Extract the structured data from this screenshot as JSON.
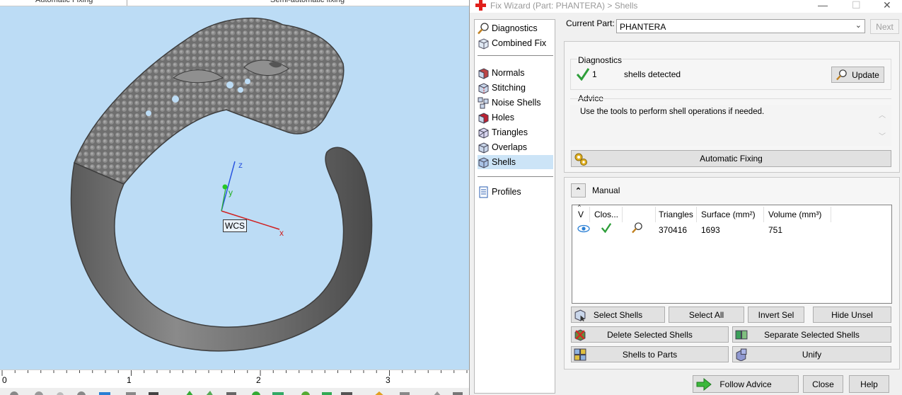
{
  "viewport": {
    "top_tabs": [
      "Automatic Fixing",
      "Semi-automatic fixing"
    ],
    "axis_labels": {
      "z": "z",
      "y": "y",
      "x": "x",
      "wcs": "WCS"
    },
    "ruler": [
      "0",
      "1",
      "2",
      "3"
    ]
  },
  "dialog": {
    "title": "Fix Wizard (Part: PHANTERA) > Shells",
    "nav": [
      {
        "label": "Diagnostics",
        "icon": "magnifier-icon"
      },
      {
        "label": "Combined Fix",
        "icon": "cube-icon"
      },
      {
        "label": "Normals",
        "icon": "normals-cube-icon"
      },
      {
        "label": "Stitching",
        "icon": "stitching-cube-icon"
      },
      {
        "label": "Noise Shells",
        "icon": "noise-shells-icon"
      },
      {
        "label": "Holes",
        "icon": "holes-cube-icon"
      },
      {
        "label": "Triangles",
        "icon": "triangles-cube-icon"
      },
      {
        "label": "Overlaps",
        "icon": "overlaps-cube-icon"
      },
      {
        "label": "Shells",
        "icon": "shells-cube-icon"
      },
      {
        "label": "Profiles",
        "icon": "document-icon"
      }
    ],
    "current_part_label": "Current Part:",
    "current_part_value": "PHANTERA",
    "next_label": "Next",
    "diagnostics": {
      "title": "Diagnostics",
      "count": "1",
      "text": "shells detected",
      "update_label": "Update"
    },
    "advice": {
      "title": "Advice",
      "text": "Use the tools to perform shell operations if needed."
    },
    "automatic_fixing_label": "Automatic Fixing",
    "manual": {
      "title": "Manual",
      "columns": [
        "V",
        "Clos...",
        "",
        "Triangles",
        "Surface (mm²)",
        "Volume (mm³)"
      ],
      "row": {
        "triangles": "370416",
        "surface": "1693",
        "volume": "751"
      }
    },
    "buttons": {
      "select_shells": "Select Shells",
      "select_all": "Select All",
      "invert_sel": "Invert Sel",
      "hide_unsel": "Hide Unsel",
      "delete_selected": "Delete Selected Shells",
      "separate_selected": "Separate Selected Shells",
      "shells_to_parts": "Shells to Parts",
      "unify": "Unify",
      "follow_advice": "Follow Advice",
      "close": "Close",
      "help": "Help"
    },
    "colors": {
      "selection": "#cce4f7",
      "check_green": "#2e9e3a",
      "viewport_bg": "#bcdcf5",
      "title_icon_red": "#e0201b"
    }
  }
}
